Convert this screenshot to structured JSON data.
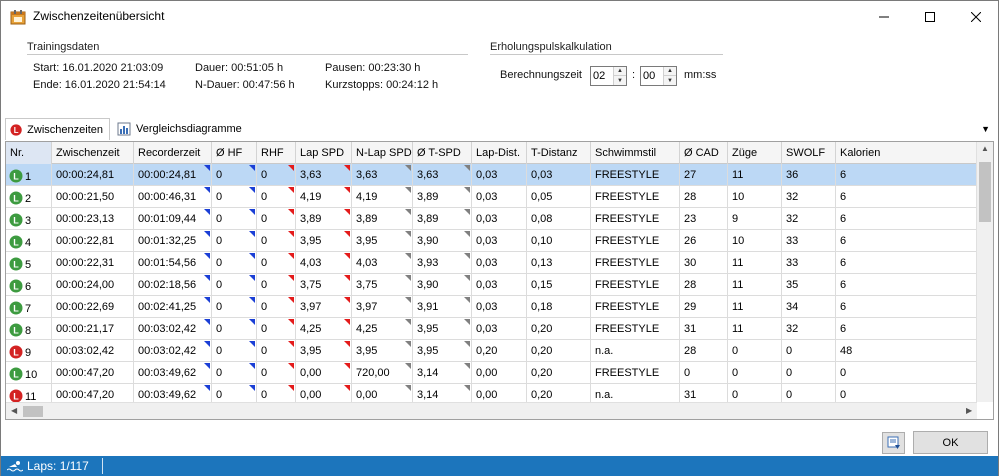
{
  "window": {
    "title": "Zwischenzeitenübersicht"
  },
  "trainingsdaten": {
    "label": "Trainingsdaten",
    "start": "Start: 16.01.2020 21:03:09",
    "ende": "Ende: 16.01.2020 21:54:14",
    "dauer": "Dauer: 00:51:05 h",
    "ndauer": "N-Dauer: 00:47:56 h",
    "pausen": "Pausen: 00:23:30 h",
    "kurzstopps": "Kurzstopps: 00:24:12 h"
  },
  "erholung": {
    "label": "Erholungspulskalkulation",
    "berechnungszeit_label": "Berechnungszeit",
    "minutes": "02",
    "seconds": "00",
    "colon": ":",
    "unit": "mm:ss"
  },
  "tabs": [
    {
      "label": "Zwischenzeiten",
      "active": true
    },
    {
      "label": "Vergleichsdiagramme",
      "active": false
    }
  ],
  "columns": [
    "Nr.",
    "Zwischenzeit",
    "Recorderzeit",
    "Ø HF",
    "RHF",
    "Lap SPD",
    "N-Lap SPD",
    "Ø T-SPD",
    "Lap-Dist.",
    "T-Distanz",
    "Schwimmstil",
    "Ø CAD",
    "Züge",
    "SWOLF",
    "Kalorien"
  ],
  "rows": [
    {
      "nr": "1",
      "icon": "green",
      "cells": [
        "00:00:24,81",
        "00:00:24,81",
        "0",
        "0",
        "3,63",
        "3,63",
        "3,63",
        "0,03",
        "0,03",
        "FREESTYLE",
        "27",
        "11",
        "36",
        "6"
      ]
    },
    {
      "nr": "2",
      "icon": "green",
      "cells": [
        "00:00:21,50",
        "00:00:46,31",
        "0",
        "0",
        "4,19",
        "4,19",
        "3,89",
        "0,03",
        "0,05",
        "FREESTYLE",
        "28",
        "10",
        "32",
        "6"
      ]
    },
    {
      "nr": "3",
      "icon": "green",
      "cells": [
        "00:00:23,13",
        "00:01:09,44",
        "0",
        "0",
        "3,89",
        "3,89",
        "3,89",
        "0,03",
        "0,08",
        "FREESTYLE",
        "23",
        "9",
        "32",
        "6"
      ]
    },
    {
      "nr": "4",
      "icon": "green",
      "cells": [
        "00:00:22,81",
        "00:01:32,25",
        "0",
        "0",
        "3,95",
        "3,95",
        "3,90",
        "0,03",
        "0,10",
        "FREESTYLE",
        "26",
        "10",
        "33",
        "6"
      ]
    },
    {
      "nr": "5",
      "icon": "green",
      "cells": [
        "00:00:22,31",
        "00:01:54,56",
        "0",
        "0",
        "4,03",
        "4,03",
        "3,93",
        "0,03",
        "0,13",
        "FREESTYLE",
        "30",
        "11",
        "33",
        "6"
      ]
    },
    {
      "nr": "6",
      "icon": "green",
      "cells": [
        "00:00:24,00",
        "00:02:18,56",
        "0",
        "0",
        "3,75",
        "3,75",
        "3,90",
        "0,03",
        "0,15",
        "FREESTYLE",
        "28",
        "11",
        "35",
        "6"
      ]
    },
    {
      "nr": "7",
      "icon": "green",
      "cells": [
        "00:00:22,69",
        "00:02:41,25",
        "0",
        "0",
        "3,97",
        "3,97",
        "3,91",
        "0,03",
        "0,18",
        "FREESTYLE",
        "29",
        "11",
        "34",
        "6"
      ]
    },
    {
      "nr": "8",
      "icon": "green",
      "cells": [
        "00:00:21,17",
        "00:03:02,42",
        "0",
        "0",
        "4,25",
        "4,25",
        "3,95",
        "0,03",
        "0,20",
        "FREESTYLE",
        "31",
        "11",
        "32",
        "6"
      ]
    },
    {
      "nr": "9",
      "icon": "red",
      "cells": [
        "00:03:02,42",
        "00:03:02,42",
        "0",
        "0",
        "3,95",
        "3,95",
        "3,95",
        "0,20",
        "0,20",
        "n.a.",
        "28",
        "0",
        "0",
        "48"
      ]
    },
    {
      "nr": "10",
      "icon": "green",
      "cells": [
        "00:00:47,20",
        "00:03:49,62",
        "0",
        "0",
        "0,00",
        "720,00",
        "3,14",
        "0,00",
        "0,20",
        "FREESTYLE",
        "0",
        "0",
        "0",
        "0"
      ]
    },
    {
      "nr": "11",
      "icon": "red",
      "cells": [
        "00:00:47,20",
        "00:03:49,62",
        "0",
        "0",
        "0,00",
        "0,00",
        "3,14",
        "0,00",
        "0,20",
        "n.a.",
        "31",
        "0",
        "0",
        "0"
      ]
    }
  ],
  "footer": {
    "ok_label": "OK"
  },
  "status": {
    "laps": "Laps: 1/117"
  },
  "colors": {
    "selection": "#bcd8f5",
    "status_bar": "#1c75bc",
    "lap_green": "#3d9b40",
    "lap_red": "#d32222"
  }
}
